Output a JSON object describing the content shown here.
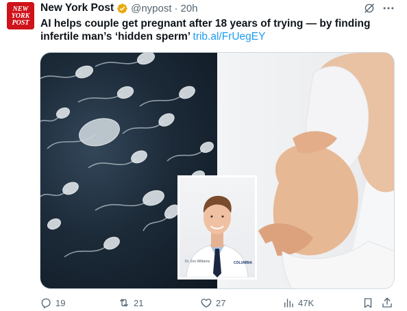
{
  "author": {
    "display_name": "New York Post",
    "handle": "@nypost",
    "separator": "·",
    "time": "20h",
    "verified_badge_color": "#e8a90f",
    "avatar_logo": [
      "NEW",
      "YORK",
      "POST"
    ],
    "avatar_color": "#d0121a"
  },
  "tweet": {
    "text": "AI helps couple get pregnant after 18 years of trying — by finding infertile man’s ‘hidden sperm’ ",
    "link": "trib.al/FrUegEY",
    "link_color": "#1d9bf0"
  },
  "media": {
    "inset_caption": "Dr. Zev Williams",
    "inset_badge": "COLUMBIA"
  },
  "actions": {
    "reply": {
      "icon": "reply-icon",
      "count": "19"
    },
    "retweet": {
      "icon": "retweet-icon",
      "count": "21"
    },
    "like": {
      "icon": "heart-icon",
      "count": "27"
    },
    "views": {
      "icon": "views-icon",
      "count": "47K"
    },
    "bookmark": {
      "icon": "bookmark-icon"
    },
    "share": {
      "icon": "share-icon"
    }
  }
}
